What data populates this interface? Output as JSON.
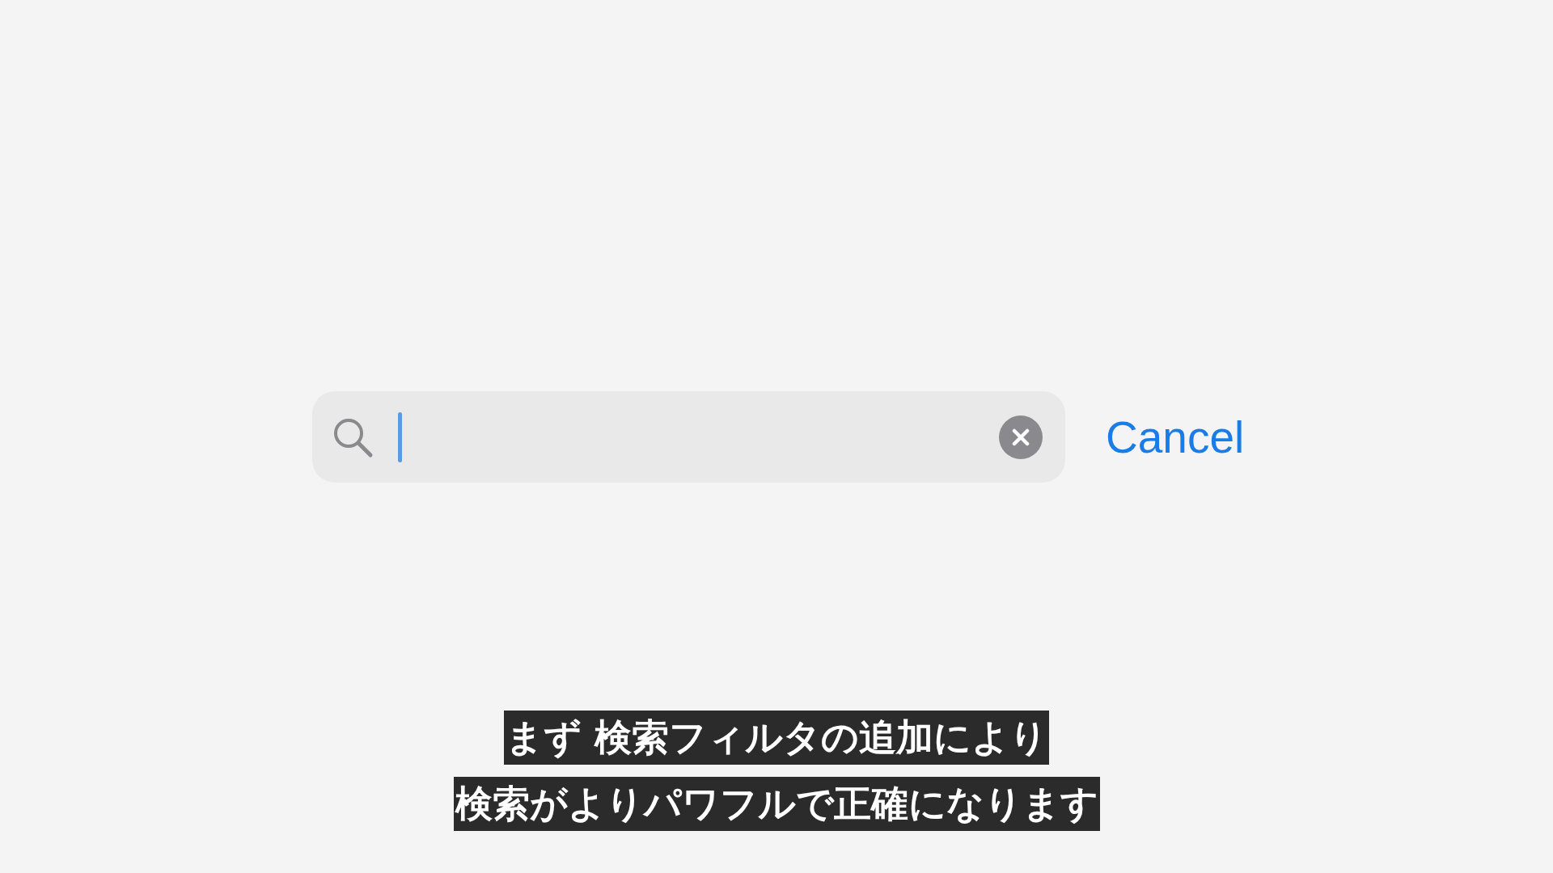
{
  "search": {
    "focused": true
  },
  "cancel_button": "Cancel",
  "subtitles": [
    "まず 検索フィルタの追加により",
    "検索がよりパワフルで正確になります"
  ]
}
